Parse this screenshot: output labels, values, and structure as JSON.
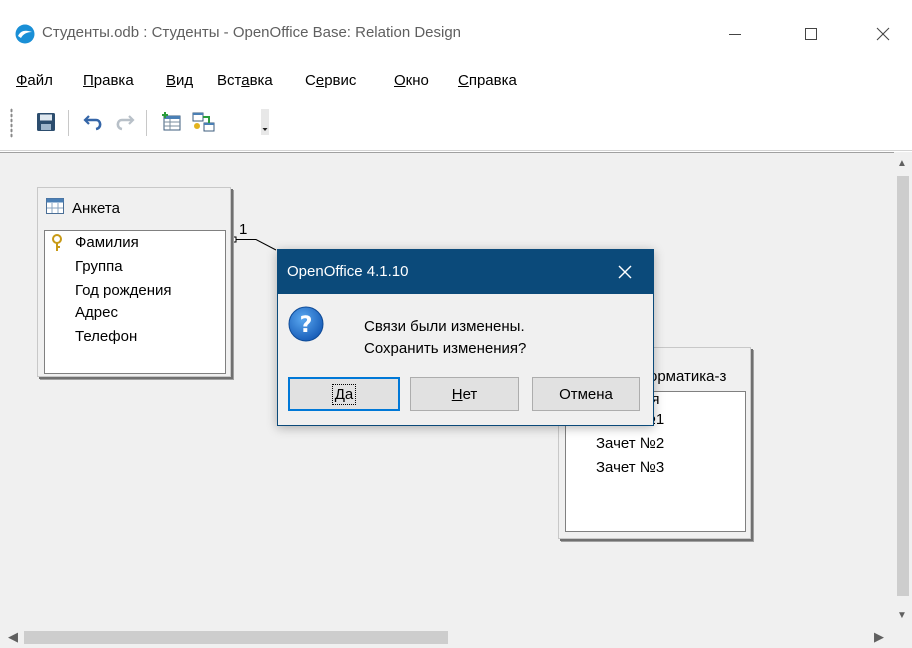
{
  "window": {
    "title": "Студенты.odb : Студенты - OpenOffice Base: Relation Design",
    "app_icon": "openoffice-gull-icon",
    "controls": [
      "minimize-icon",
      "maximize-icon",
      "close-icon"
    ]
  },
  "menu": {
    "items": [
      {
        "acc": "Ф",
        "rest": "айл"
      },
      {
        "acc": "П",
        "rest": "равка"
      },
      {
        "acc": "В",
        "rest": "ид"
      },
      {
        "pre": "Вст",
        "acc": "а",
        "rest": "вка"
      },
      {
        "pre": "С",
        "acc": "е",
        "rest": "рвис"
      },
      {
        "acc": "О",
        "rest": "кно"
      },
      {
        "acc": "С",
        "rest": "правка"
      }
    ]
  },
  "toolbar": {
    "buttons": [
      "save-icon",
      "undo-icon",
      "redo-icon",
      "add-tables-icon",
      "new-relation-icon",
      "toolbar-options-icon"
    ]
  },
  "tables": [
    {
      "name": "Анкета",
      "fields": [
        "Фамилия",
        "Группа",
        "Год рождения",
        "Адрес",
        "Телефон"
      ],
      "key_field": "Фамилия"
    },
    {
      "name": "Информатика-зачеты",
      "visible_title": "орматика-з",
      "fields": [
        "Фамилия",
        "Зачет №1",
        "Зачет №2",
        "Зачет №3"
      ],
      "visible_first_field": "ия"
    }
  ],
  "relation": {
    "cardinality_label": "1"
  },
  "dialog": {
    "title": "OpenOffice 4.1.10",
    "icon": "question-icon",
    "message_line1": "Связи были изменены.",
    "message_line2": "Сохранить изменения?",
    "buttons": {
      "yes": {
        "acc": "Д",
        "rest": "а"
      },
      "no": {
        "acc": "Н",
        "rest": "ет"
      },
      "cancel": {
        "label": "Отмена"
      }
    }
  },
  "colors": {
    "dialog_title_bg": "#0b4a7a",
    "default_button_border": "#0078d7",
    "workarea_bg": "#f0f0f0"
  }
}
